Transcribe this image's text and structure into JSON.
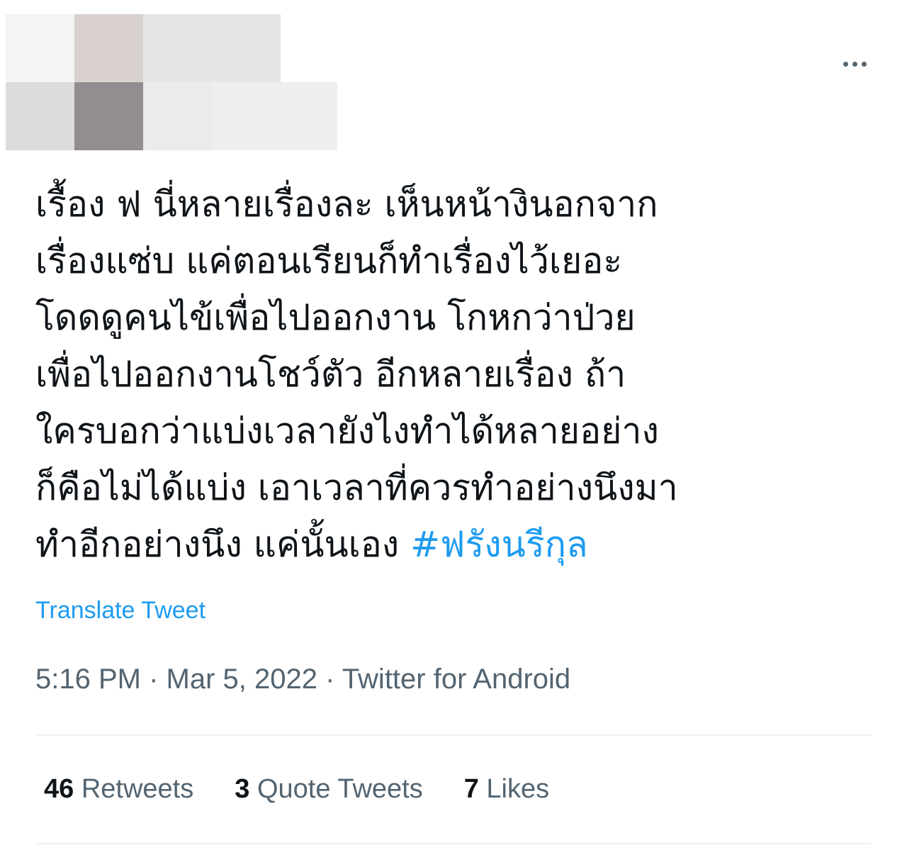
{
  "header": {
    "censored_avatar_and_name": true,
    "pixel_colors": [
      [
        "#f4f4f4",
        "#d9d1cd",
        "#e6e6e6",
        "#e6e6e6",
        null
      ],
      [
        "#dcdcde",
        "#938c91",
        "#eaebed",
        "#edeef0",
        "#eeeff1"
      ]
    ],
    "more_options_icon": "more-horizontal-icon"
  },
  "tweet": {
    "lines": [
      "เรื้อง ฟ นี่หลายเรื่องละ เห็นหน้างินอกจาก",
      "เรื่องแซ่บ แค่ตอนเรียนก็ทำเรื่องไว้เยอะ",
      "โดดดูคนไข้เพื่อไปออกงาน โกหกว่าป่วย",
      "เพื่อไปออกงานโชว์ตัว อีกหลายเรื่อง ถ้า",
      "ใครบอกว่าแบ่งเวลายังไงทำได้หลายอย่าง",
      "ก็คือไม่ได้แบ่ง เอาเวลาที่ควรทำอย่างนึงมา",
      "ทำอีกอย่างนึง แค่นั้นเอง "
    ],
    "hashtag": "#ฟรังนรีกุล",
    "translate_label": "Translate Tweet",
    "time": "5:16 PM",
    "date": "Mar 5, 2022",
    "source": "Twitter for Android",
    "separator": " · "
  },
  "stats": {
    "retweets_count": "46",
    "retweets_label": " Retweets",
    "quotes_count": "3",
    "quotes_label": " Quote Tweets",
    "likes_count": "7",
    "likes_label": " Likes"
  },
  "colors": {
    "accent": "#1d9bf0",
    "text_primary": "#0f1419",
    "text_secondary": "#536471",
    "divider": "#eff3f4"
  }
}
